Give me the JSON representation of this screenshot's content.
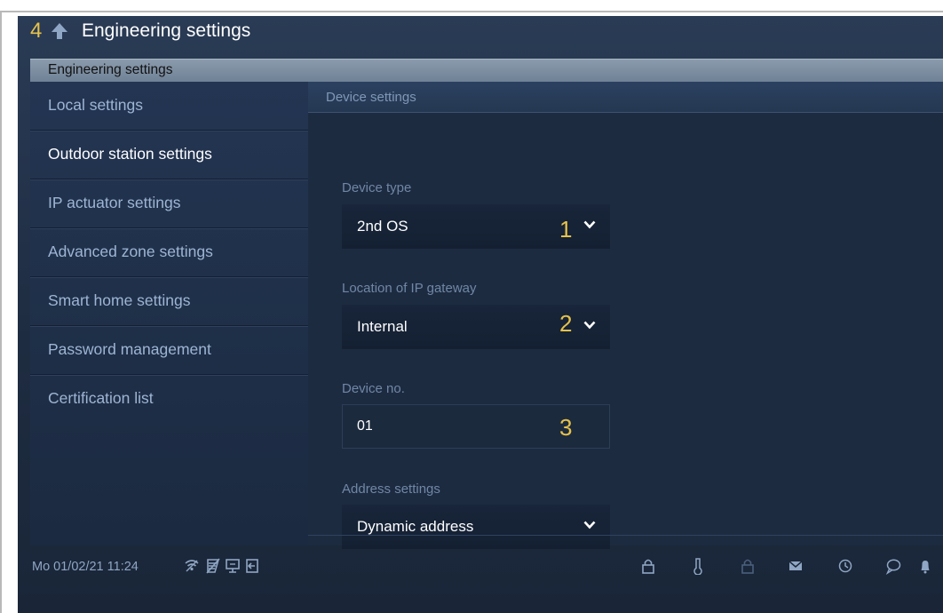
{
  "header": {
    "callout": "4",
    "title": "Engineering settings",
    "section": "Engineering settings",
    "back_icon": "back-arrow-icon"
  },
  "sidebar": {
    "items": [
      {
        "label": "Local settings",
        "active": false
      },
      {
        "label": "Outdoor station settings",
        "active": true
      },
      {
        "label": "IP actuator settings",
        "active": false
      },
      {
        "label": "Advanced zone settings",
        "active": false
      },
      {
        "label": "Smart home settings",
        "active": false
      },
      {
        "label": "Password management",
        "active": false
      },
      {
        "label": "Certification list",
        "active": false
      }
    ]
  },
  "content": {
    "header": "Device settings",
    "device_type": {
      "label": "Device type",
      "value": "2nd OS",
      "callout": "1"
    },
    "ip_gateway": {
      "label": "Location of IP gateway",
      "value": "Internal",
      "callout": "2"
    },
    "device_no": {
      "label": "Device no.",
      "value": "01",
      "callout": "3"
    },
    "address": {
      "label": "Address settings",
      "value": "Dynamic address"
    }
  },
  "status": {
    "datetime": "Mo 01/02/21  11:24",
    "left_icons": [
      "wifi-icon",
      "mute-icon",
      "monitor-icon",
      "exit-icon"
    ],
    "right_icons": [
      "lock-icon",
      "thermometer-icon",
      "lock-closed-icon",
      "mail-icon",
      "history-icon",
      "message-icon",
      "bell-icon"
    ]
  },
  "colors": {
    "accent_callout": "#e6c24a",
    "background": "#1e2c41",
    "sidebar_text": "#9db5d3",
    "active_text": "#ffffff"
  }
}
